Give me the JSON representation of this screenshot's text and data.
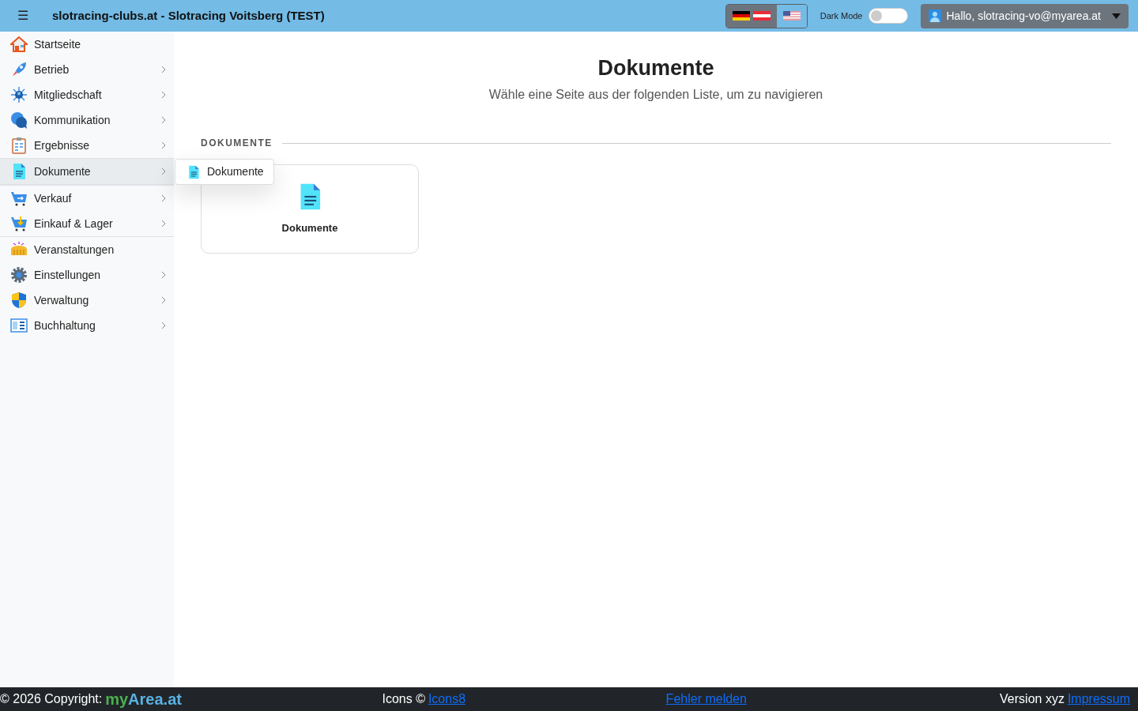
{
  "navbar": {
    "menu_glyph": "☰",
    "title": "slotracing-clubs.at - Slotracing Voitsberg (TEST)",
    "languages": [
      {
        "kind": "de_at",
        "selected": false
      },
      {
        "kind": "us",
        "selected": true
      }
    ],
    "dark_mode": {
      "label": "Dark Mode",
      "on": false
    },
    "user_menu": {
      "label": "Hallo, slotracing-vo@myarea.at"
    }
  },
  "sidebar": {
    "items": [
      {
        "kind": "home",
        "label": "Startseite",
        "has_submenu": false,
        "selected": false,
        "divider_before": false
      },
      {
        "kind": "rocket",
        "label": "Betrieb",
        "has_submenu": true,
        "selected": false,
        "divider_before": false
      },
      {
        "kind": "network",
        "label": "Mitgliedschaft",
        "has_submenu": true,
        "selected": false,
        "divider_before": false
      },
      {
        "kind": "chat",
        "label": "Kommunikation",
        "has_submenu": true,
        "selected": false,
        "divider_before": false
      },
      {
        "kind": "clipboard",
        "label": "Ergebnisse",
        "has_submenu": true,
        "selected": false,
        "divider_before": false
      },
      {
        "kind": "document",
        "label": "Dokumente",
        "has_submenu": true,
        "selected": true,
        "divider_before": false
      },
      {
        "kind": "cart",
        "label": "Verkauf",
        "has_submenu": true,
        "selected": false,
        "divider_before": true
      },
      {
        "kind": "cart_down",
        "label": "Einkauf & Lager",
        "has_submenu": true,
        "selected": false,
        "divider_before": false
      },
      {
        "kind": "stadium",
        "label": "Veranstaltungen",
        "has_submenu": false,
        "selected": false,
        "divider_before": true
      },
      {
        "kind": "gear",
        "label": "Einstellungen",
        "has_submenu": true,
        "selected": false,
        "divider_before": false
      },
      {
        "kind": "shield",
        "label": "Verwaltung",
        "has_submenu": true,
        "selected": false,
        "divider_before": false
      },
      {
        "kind": "ledger",
        "label": "Buchhaltung",
        "has_submenu": true,
        "selected": false,
        "divider_before": false
      }
    ]
  },
  "submenu": {
    "items": [
      {
        "kind": "document",
        "label": "Dokumente"
      }
    ]
  },
  "main": {
    "title": "Dokumente",
    "subtitle": "Wähle eine Seite aus der folgenden Liste, um zu navigieren",
    "section": "DOKUMENTE",
    "tiles": [
      {
        "kind": "document",
        "label": "Dokumente"
      }
    ]
  },
  "footer": {
    "copyright": "© 2026 Copyright:",
    "brand_first": "my",
    "brand_second": "Area.at",
    "icons_text": "Icons ©",
    "icons_link": "Icons8",
    "report_link": "Fehler melden",
    "version": "Version xyz",
    "imprint_link": "Impressum"
  }
}
